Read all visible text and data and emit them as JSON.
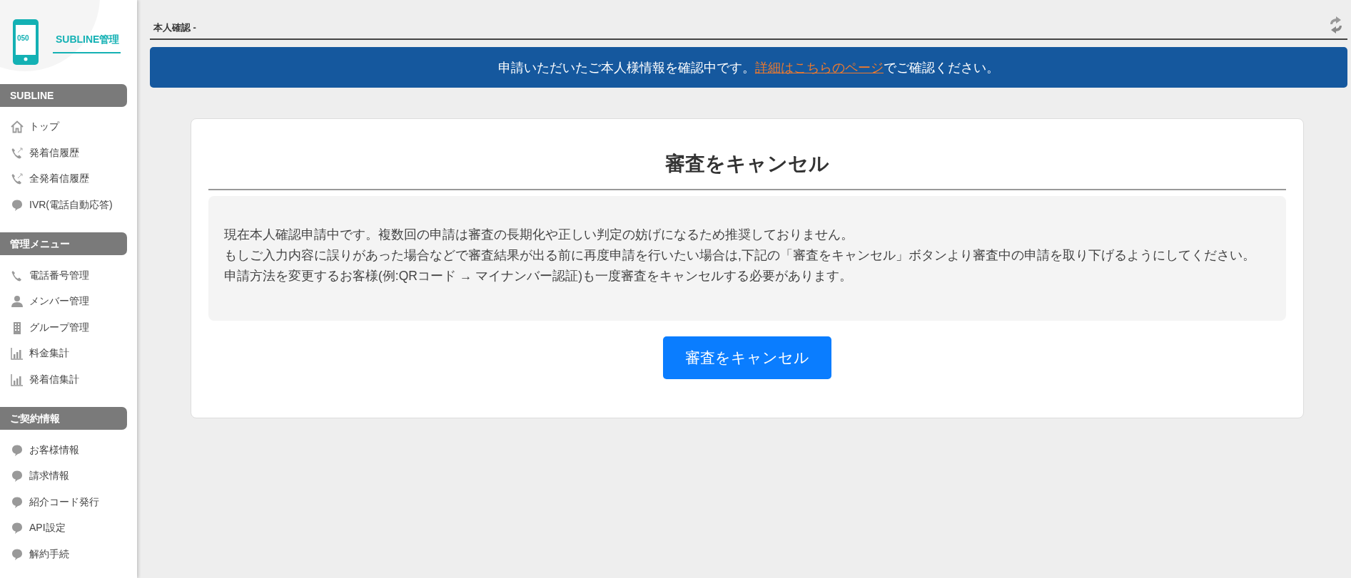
{
  "sidebar": {
    "brand": "SUBLINE管理",
    "logo_text": "050",
    "sections": [
      {
        "title": "SUBLINE",
        "items": [
          {
            "label": "トップ",
            "kind": "home"
          },
          {
            "label": "発着信履歴",
            "kind": "call-history"
          },
          {
            "label": "全発着信履歴",
            "kind": "call-history"
          },
          {
            "label": "IVR(電話自動応答)",
            "kind": "bubble"
          }
        ]
      },
      {
        "title": "管理メニュー",
        "items": [
          {
            "label": "電話番号管理",
            "kind": "phone"
          },
          {
            "label": "メンバー管理",
            "kind": "member"
          },
          {
            "label": "グループ管理",
            "kind": "building"
          },
          {
            "label": "料金集計",
            "kind": "chart"
          },
          {
            "label": "発着信集計",
            "kind": "chart"
          }
        ]
      },
      {
        "title": "ご契約情報",
        "items": [
          {
            "label": "お客様情報",
            "kind": "bubble"
          },
          {
            "label": "請求情報",
            "kind": "bubble"
          },
          {
            "label": "紹介コード発行",
            "kind": "bubble"
          },
          {
            "label": "API設定",
            "kind": "bubble"
          },
          {
            "label": "解約手続",
            "kind": "bubble"
          }
        ]
      }
    ]
  },
  "page_title": "本人確認 -",
  "banner": {
    "before": "申請いただいたご本人様情報を確認中です。",
    "link": "詳細はこちらのページ",
    "after": "でご確認ください。"
  },
  "card": {
    "title": "審査をキャンセル",
    "paragraphs": [
      "現在本人確認申請中です。複数回の申請は審査の長期化や正しい判定の妨げになるため推奨しておりません。",
      "もしご入力内容に誤りがあった場合などで審査結果が出る前に再度申請を行いたい場合は,下記の「審査をキャンセル」ボタンより審査中の申請を取り下げるようにしてください。",
      "申請方法を変更するお客様(例:QRコード → マイナンバー認証)も一度審査をキャンセルする必要があります。"
    ],
    "button": "審査をキャンセル"
  }
}
